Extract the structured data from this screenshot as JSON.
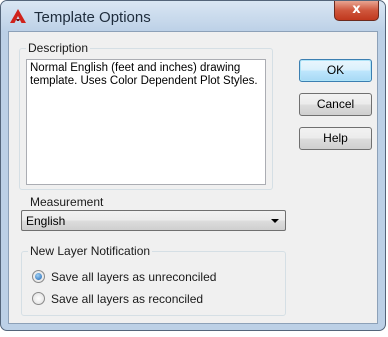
{
  "window": {
    "title": "Template Options",
    "close_glyph": "x",
    "app_icon": "autocad-a-icon"
  },
  "description": {
    "label": "Description",
    "text": "Normal English (feet and inches) drawing template. Uses Color Dependent Plot Styles."
  },
  "buttons": {
    "ok": "OK",
    "cancel": "Cancel",
    "help": "Help"
  },
  "measurement": {
    "label": "Measurement",
    "selected": "English"
  },
  "notification": {
    "label": "New Layer Notification",
    "options": [
      {
        "label": "Save all layers as unreconciled",
        "checked": true
      },
      {
        "label": "Save all layers as reconciled",
        "checked": false
      }
    ]
  },
  "colors": {
    "close_button": "#c0381e",
    "icon_red": "#d0221b"
  }
}
